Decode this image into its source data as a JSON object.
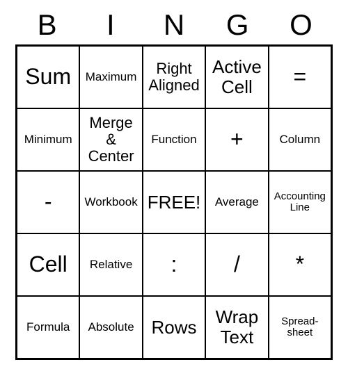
{
  "header": [
    "B",
    "I",
    "N",
    "G",
    "O"
  ],
  "cells": [
    [
      {
        "label": "Sum",
        "size": "xl"
      },
      {
        "label": "Maximum",
        "size": "s"
      },
      {
        "label": "Right Aligned",
        "size": "m"
      },
      {
        "label": "Active Cell",
        "size": "l"
      },
      {
        "label": "=",
        "size": "xl"
      }
    ],
    [
      {
        "label": "Minimum",
        "size": "s"
      },
      {
        "label": "Merge & Center",
        "size": "m"
      },
      {
        "label": "Function",
        "size": "s"
      },
      {
        "label": "+",
        "size": "xl"
      },
      {
        "label": "Column",
        "size": "s"
      }
    ],
    [
      {
        "label": "-",
        "size": "xl"
      },
      {
        "label": "Workbook",
        "size": "s"
      },
      {
        "label": "FREE!",
        "size": "l"
      },
      {
        "label": "Average",
        "size": "s"
      },
      {
        "label": "Accounting Line",
        "size": "xs"
      }
    ],
    [
      {
        "label": "Cell",
        "size": "xl"
      },
      {
        "label": "Relative",
        "size": "s"
      },
      {
        "label": ":",
        "size": "xl"
      },
      {
        "label": "/",
        "size": "xl"
      },
      {
        "label": "*",
        "size": "xl"
      }
    ],
    [
      {
        "label": "Formula",
        "size": "s"
      },
      {
        "label": "Absolute",
        "size": "s"
      },
      {
        "label": "Rows",
        "size": "l"
      },
      {
        "label": "Wrap Text",
        "size": "l"
      },
      {
        "label": "Spread-sheet",
        "size": "xs"
      }
    ]
  ]
}
